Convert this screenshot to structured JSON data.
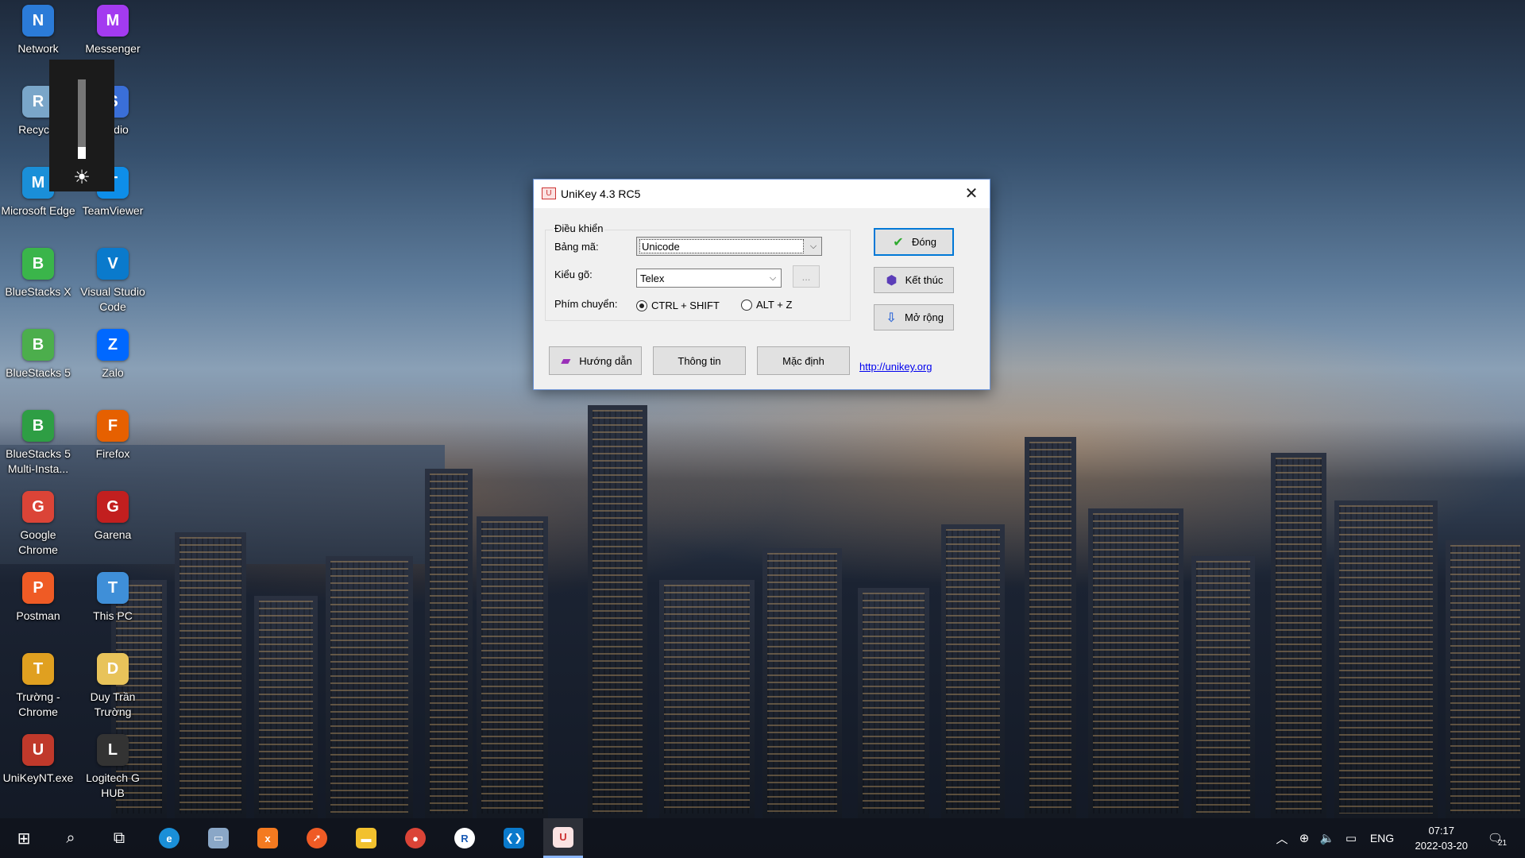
{
  "desktop": {
    "icons_col1": [
      {
        "label": "Network",
        "icon": "network-icon",
        "color": "#2b7bd8"
      },
      {
        "label": "Recycle",
        "icon": "recycle-bin-icon",
        "color": "#7aa6c9"
      },
      {
        "label": "Microsoft Edge",
        "icon": "edge-icon",
        "color": "#1a8fd8"
      },
      {
        "label": "BlueStacks X",
        "icon": "bluestacks-x-icon",
        "color": "#3ab54a"
      },
      {
        "label": "BlueStacks 5",
        "icon": "bluestacks-5-icon",
        "color": "#4cae4c"
      },
      {
        "label": "BlueStacks 5 Multi-Insta...",
        "icon": "bluestacks-multi-icon",
        "color": "#2e9e44"
      },
      {
        "label": "Google Chrome",
        "icon": "chrome-icon",
        "color": "#db4437"
      },
      {
        "label": "Postman",
        "icon": "postman-icon",
        "color": "#ef5b25"
      },
      {
        "label": "Trường - Chrome",
        "icon": "chrome-profile-icon",
        "color": "#e0a020"
      },
      {
        "label": "UniKeyNT.exe",
        "icon": "unikey-icon",
        "color": "#c0392b"
      }
    ],
    "icons_col2": [
      {
        "label": "Messenger",
        "icon": "messenger-icon",
        "color": "#a33bf0"
      },
      {
        "label": "Studio",
        "icon": "studio-icon",
        "color": "#3a6fd8"
      },
      {
        "label": "TeamViewer",
        "icon": "teamviewer-icon",
        "color": "#0e8ee9"
      },
      {
        "label": "Visual Studio Code",
        "icon": "vscode-icon",
        "color": "#0a7acc"
      },
      {
        "label": "Zalo",
        "icon": "zalo-icon",
        "color": "#0068ff"
      },
      {
        "label": "Firefox",
        "icon": "firefox-icon",
        "color": "#e66000"
      },
      {
        "label": "Garena",
        "icon": "garena-icon",
        "color": "#c21f1f"
      },
      {
        "label": "This PC",
        "icon": "this-pc-icon",
        "color": "#3f8fd8"
      },
      {
        "label": "Duy Trần Trường",
        "icon": "user-folder-icon",
        "color": "#e8c35a"
      },
      {
        "label": "Logitech G HUB",
        "icon": "logitech-icon",
        "color": "#333333"
      }
    ]
  },
  "unikey": {
    "title": "UniKey 4.3 RC5",
    "group_label": "Điều khiển",
    "bang_ma_label": "Bảng mã:",
    "bang_ma_value": "Unicode",
    "kieu_go_label": "Kiểu gõ:",
    "kieu_go_value": "Telex",
    "more_button": "...",
    "phim_chuyen_label": "Phím chuyển:",
    "radio_1": "CTRL + SHIFT",
    "radio_2": "ALT + Z",
    "btn_dong": "Đóng",
    "btn_ket_thuc": "Kết thúc",
    "btn_mo_rong": "Mở rộng",
    "btn_huong_dan": "Hướng dẫn",
    "btn_thong_tin": "Thông tin",
    "btn_mac_dinh": "Mặc định",
    "link": "http://unikey.org"
  },
  "taskbar": {
    "language": "ENG",
    "time": "07:17",
    "date": "2022-03-20",
    "notification_count": "21"
  }
}
